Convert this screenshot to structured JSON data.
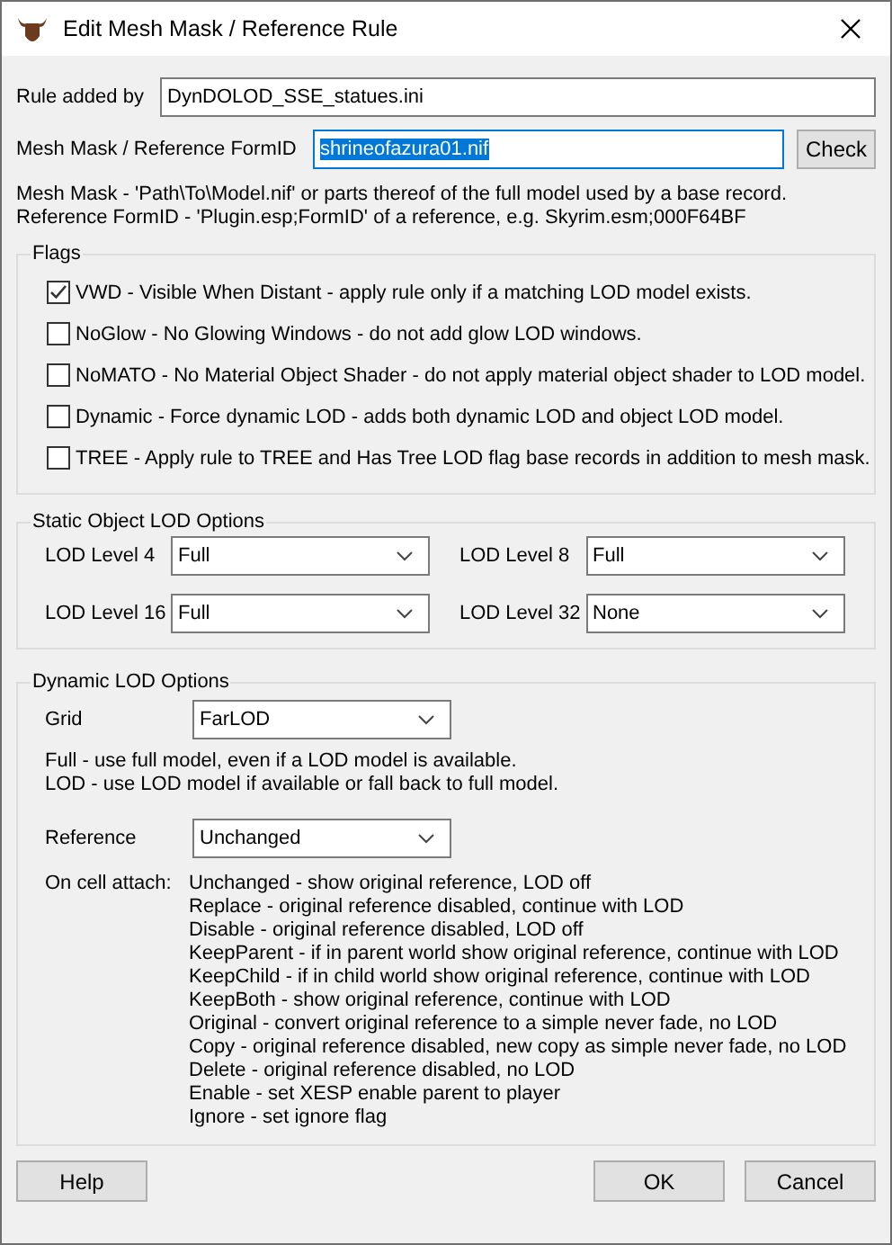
{
  "window": {
    "title": "Edit Mesh Mask / Reference Rule"
  },
  "rule_added_by": {
    "label": "Rule added by",
    "value": "DynDOLOD_SSE_statues.ini"
  },
  "mesh_mask": {
    "label": "Mesh Mask / Reference FormID",
    "value": "shrineofazura01.nif",
    "text_selected": true,
    "button": "Check"
  },
  "help_lines": [
    "Mesh Mask - 'Path\\To\\Model.nif' or parts thereof of the full model used by a base record.",
    "Reference FormID - 'Plugin.esp;FormID' of a reference, e.g. Skyrim.esm;000F64BF"
  ],
  "flags": {
    "title": "Flags",
    "items": [
      {
        "label": "VWD - Visible When Distant - apply rule only if a matching LOD model exists.",
        "checked": true
      },
      {
        "label": "NoGlow - No Glowing Windows - do not add glow LOD windows.",
        "checked": false
      },
      {
        "label": "NoMATO - No Material Object Shader - do not apply material object shader to LOD model.",
        "checked": false
      },
      {
        "label": "Dynamic - Force dynamic LOD - adds both dynamic LOD and object LOD model.",
        "checked": false
      },
      {
        "label": "TREE - Apply rule to TREE and Has Tree LOD flag base records in addition to mesh mask.",
        "checked": false
      }
    ]
  },
  "static_options": {
    "title": "Static Object LOD Options",
    "levels": [
      {
        "label": "LOD Level 4",
        "value": "Full"
      },
      {
        "label": "LOD Level 8",
        "value": "Full"
      },
      {
        "label": "LOD Level 16",
        "value": "Full"
      },
      {
        "label": "LOD Level 32",
        "value": "None"
      }
    ]
  },
  "dynamic_options": {
    "title": "Dynamic LOD Options",
    "grid": {
      "label": "Grid",
      "value": "FarLOD"
    },
    "grid_help": [
      "Full - use full model, even if a LOD model is available.",
      "LOD - use LOD model if available or fall back to full model."
    ],
    "reference": {
      "label": "Reference",
      "value": "Unchanged"
    },
    "attach_label": "On cell attach:",
    "attach_lines": [
      "Unchanged - show original reference, LOD off",
      "Replace - original reference disabled, continue with LOD",
      "Disable - original reference disabled, LOD off",
      "KeepParent - if in parent world show original reference, continue with LOD",
      "KeepChild - if in child world show original reference, continue with LOD",
      "KeepBoth - show original reference, continue with LOD",
      "Original - convert original reference to a simple never fade, no LOD",
      "Copy - original reference disabled, new copy as simple never fade, no LOD",
      "Delete - original reference disabled, no LOD",
      "Enable - set XESP enable parent to player",
      "Ignore - set ignore flag"
    ]
  },
  "buttons": {
    "help": "Help",
    "ok": "OK",
    "cancel": "Cancel"
  }
}
